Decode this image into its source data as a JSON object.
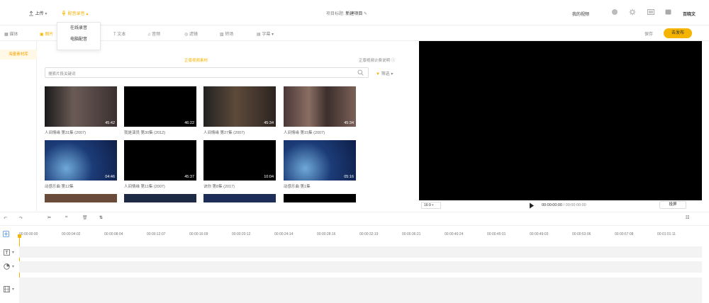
{
  "topbar": {
    "upload_label": "上传",
    "record_label": "配音录音",
    "project_prefix": "项目标题:",
    "project_name": "新建项目",
    "my_videos": "我的视频",
    "user_name": "百晓文"
  },
  "record_menu": {
    "items": [
      "在线录音",
      "电脑配音"
    ]
  },
  "tabs": {
    "items": [
      "媒体",
      "图片",
      "文本",
      "音频",
      "滤镜",
      "转场",
      "字幕"
    ],
    "save_label": "保存",
    "export_label": "去发布"
  },
  "leftnav": {
    "active_item": "海量素材库"
  },
  "library": {
    "header": "正版视频素材",
    "billing_link": "正版视频计费说明",
    "search_placeholder": "搜索片段关键词",
    "filter_label": "筛选",
    "clips": [
      {
        "duration": "45:42",
        "caption": "人间情缘 第31集 (2007)"
      },
      {
        "duration": "46:22",
        "caption": "我是演员 第30集 (2012)"
      },
      {
        "duration": "45:34",
        "caption": "人间情缘 第27集 (2007)"
      },
      {
        "duration": "45:34",
        "caption": "人间情缘 第15集 (2007)"
      },
      {
        "duration": "04:46",
        "caption": "动感乐曲 第12集"
      },
      {
        "duration": "45:37",
        "caption": "人间情缘 第11集 (2007)"
      },
      {
        "duration": "10:04",
        "caption": "诀你 第8集 (2017)"
      },
      {
        "duration": "05:16",
        "caption": "动感乐曲 第1集"
      }
    ]
  },
  "player": {
    "aspect_ratio": "16:9",
    "current_time": "00:00:00:00",
    "total_time": "00:00:00:00",
    "side_button": "投屏"
  },
  "timeline": {
    "ticks": [
      "00:00:00:00",
      "00:00:04:02",
      "00:00:08:04",
      "00:00:12:07",
      "00:00:16:09",
      "00:00:20:12",
      "00:00:24:14",
      "00:00:28:16",
      "00:00:32:19",
      "00:00:36:21",
      "00:00:40:24",
      "00:00:45:01",
      "00:00:49:03",
      "00:00:53:06",
      "00:00:57:08",
      "00:01:01:11"
    ]
  },
  "colors": {
    "accent": "#f5b400",
    "preview_bg": "#000000",
    "track_bg": "#f3f3f3"
  }
}
